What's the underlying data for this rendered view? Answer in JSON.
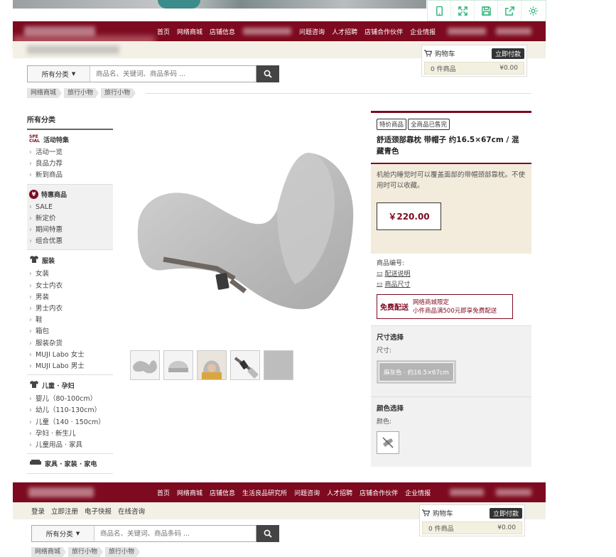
{
  "toolbar": {
    "icons": [
      "phone-icon",
      "expand-icon",
      "save-icon",
      "share-icon",
      "settings-icon"
    ],
    "accent": "#2fb37a"
  },
  "colors": {
    "brand": "#7e0a1f",
    "beige": "#f3ecdc"
  },
  "nav": {
    "items": [
      "首页",
      "网络商城",
      "店铺信息",
      "问题咨询",
      "人才招聘",
      "店铺合作伙伴",
      "企业情报"
    ]
  },
  "nav2": {
    "items": [
      "首页",
      "网络商城",
      "店铺信息",
      "生活良品研究所",
      "问题咨询",
      "人才招聘",
      "店铺合作伙伴",
      "企业情报"
    ]
  },
  "subbar": {
    "links": [
      "登录",
      "立即注册",
      "电子快报",
      "在线咨询"
    ]
  },
  "cart": {
    "title": "购物车",
    "checkout": "立即付款",
    "count": "0 件商品",
    "total": "¥0.00"
  },
  "search": {
    "category": "所有分类",
    "placeholder": "商品名、关键词、商品条码 ..."
  },
  "breadcrumb": [
    "网络商城",
    "旅行小物",
    "旅行小物"
  ],
  "sidebar": {
    "heading": "所有分类",
    "sections": [
      {
        "title": "活动特集",
        "icon": "special-icon",
        "gray": false,
        "items": [
          "活动一览",
          "良品力荐",
          "新到商品"
        ]
      },
      {
        "title": "特惠商品",
        "icon": "yen-icon",
        "gray": true,
        "items": [
          "SALE",
          "新定价",
          "期间特惠",
          "组合优惠"
        ]
      },
      {
        "title": "服装",
        "icon": "shirt-icon",
        "gray": false,
        "items": [
          "女装",
          "女士内衣",
          "男装",
          "男士内衣",
          "鞋",
          "箱包",
          "服装杂货",
          "MUJI Labo 女士",
          "MUJI Labo 男士"
        ]
      },
      {
        "title": "儿童 · 孕妇",
        "icon": "kids-icon",
        "gray": false,
        "items": [
          "婴儿（80-100cm）",
          "幼儿（110-130cm）",
          "儿童（140 · 150cm）",
          "孕妇 · 新生儿",
          "儿童用品 · 家具"
        ]
      },
      {
        "title": "家具 · 家装 · 家电",
        "icon": "sofa-icon",
        "gray": false,
        "items": []
      }
    ]
  },
  "product": {
    "tags": [
      "特价商品",
      "全商品已售完"
    ],
    "name": "舒适颈部靠枕 带帽子 约16.5×67cm / 混藏青色",
    "description": "机舱内睡觉时可以覆盖面部的带帽颈部靠枕。不使用时可以收藏。",
    "price": "￥220.00",
    "code_label": "商品编号:",
    "links": [
      "配送说明",
      "商品尺寸"
    ],
    "free_shipping": {
      "badge": "免费配送",
      "line1": "网络商城限定",
      "line2": "小件商品满500元即享免费配送"
    },
    "size": {
      "title": "尺寸选择",
      "label": "尺寸:",
      "option": "麻灰色 · 约16.5×67cm"
    },
    "color": {
      "title": "颜色选择",
      "label": "颜色:"
    },
    "thumb_count": 5
  }
}
